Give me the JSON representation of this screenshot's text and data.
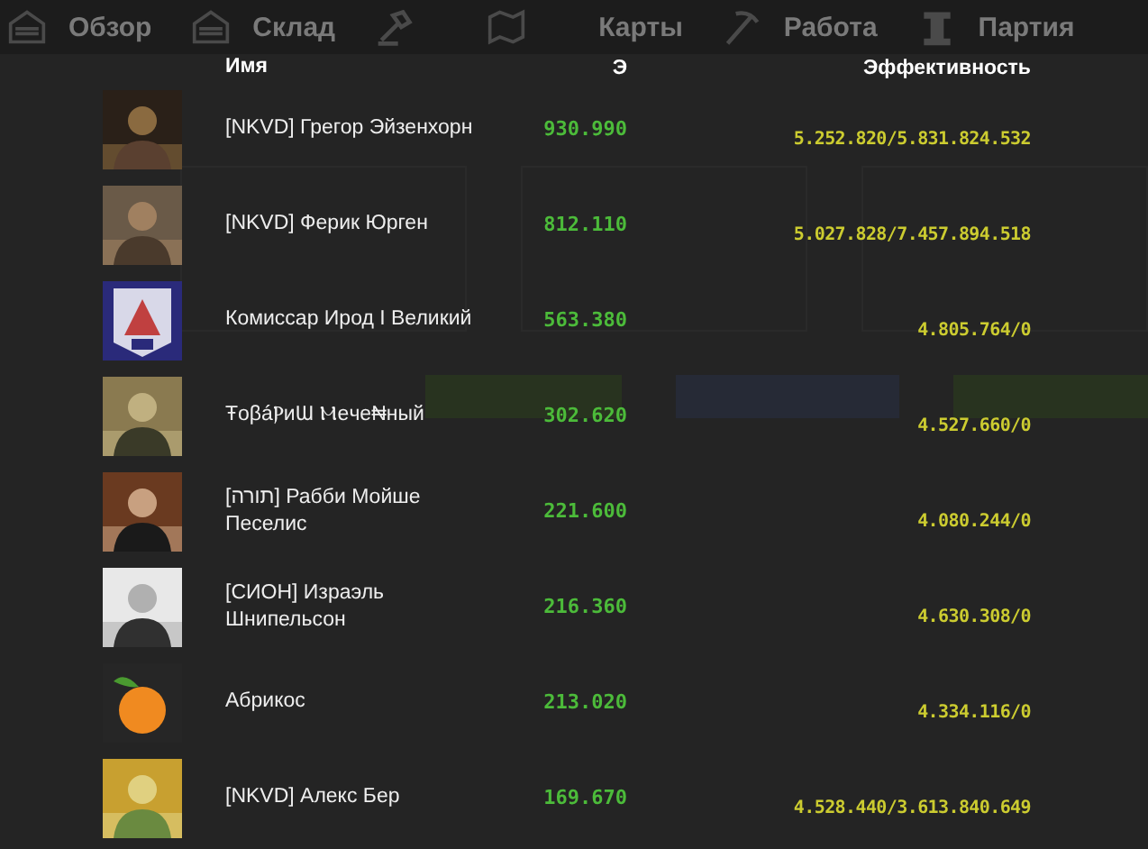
{
  "nav": [
    {
      "label": "Обзор"
    },
    {
      "label": "Склад"
    },
    {
      "label": "Карты"
    },
    {
      "label": "Работа"
    },
    {
      "label": "Партия"
    }
  ],
  "table": {
    "columns": [
      "Имя",
      "Э",
      "Эффективность"
    ],
    "rows": [
      {
        "name": "[NKVD] Грегор Эйзенхорн",
        "energy": "930.990",
        "efficiency": "5.252.820/5.831.824.532"
      },
      {
        "name": "[NKVD] Ферик Юрген",
        "energy": "812.110",
        "efficiency": "5.027.828/7.457.894.518"
      },
      {
        "name": "Комиссар Ирод I Великий",
        "energy": "563.380",
        "efficiency": "4.805.764/0"
      },
      {
        "name": "ŦoβáⲢиƜ Ⲙeчe₦ный",
        "energy": "302.620",
        "efficiency": "4.527.660/0"
      },
      {
        "name": "[תורה] Рабби Мойше Песелис",
        "energy": "221.600",
        "efficiency": "4.080.244/0"
      },
      {
        "name": "[СИОН] Израэль Шнипельсон",
        "energy": "216.360",
        "efficiency": "4.630.308/0"
      },
      {
        "name": "Абрикос",
        "energy": "213.020",
        "efficiency": "4.334.116/0"
      },
      {
        "name": "[NKVD] Алекс Бер",
        "energy": "169.670",
        "efficiency": "4.528.440/3.613.840.649"
      }
    ]
  }
}
